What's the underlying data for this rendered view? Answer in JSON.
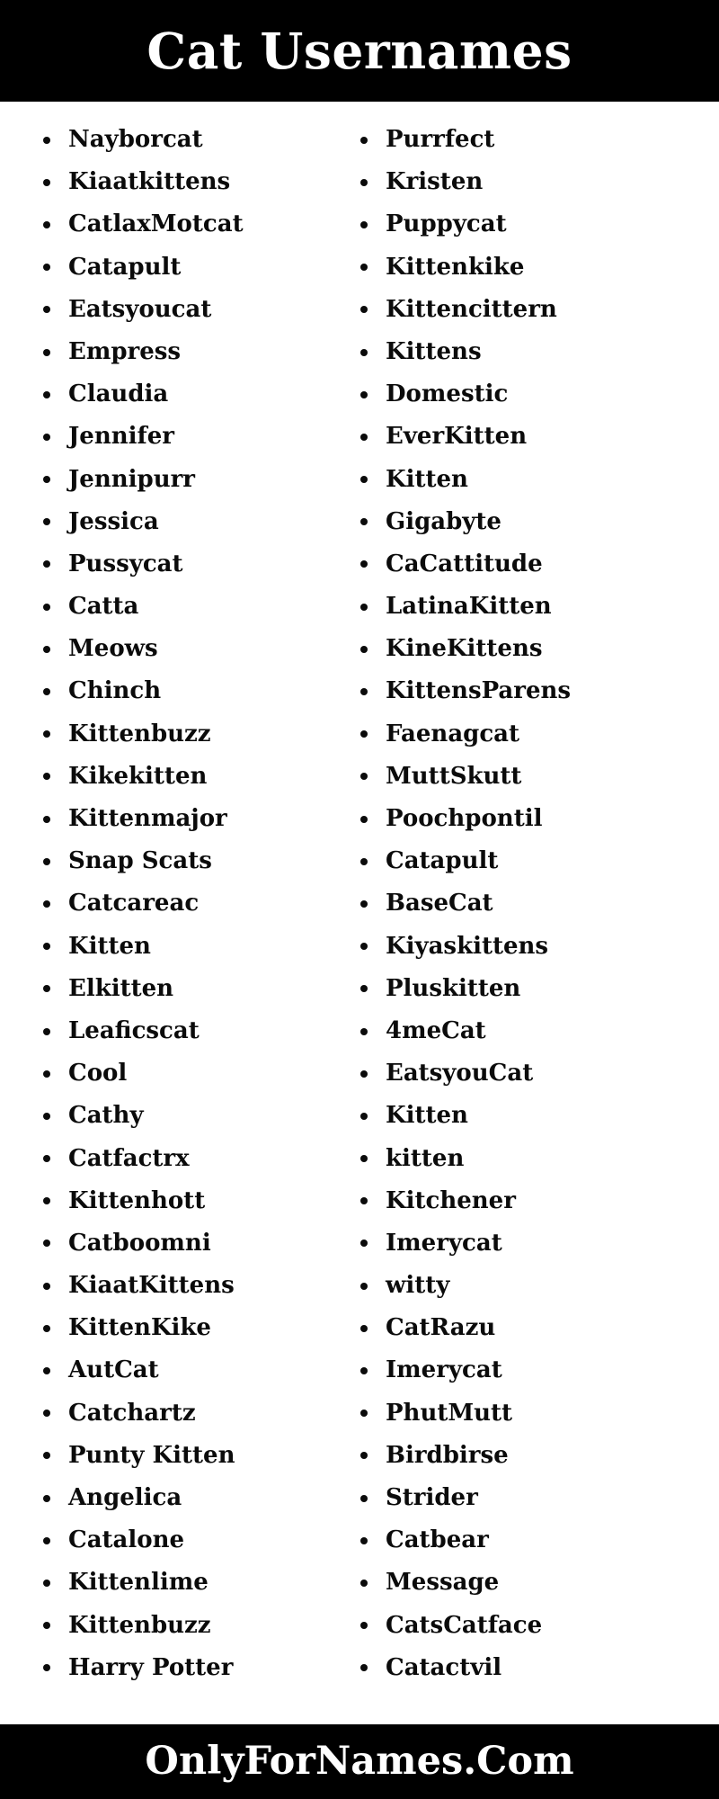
{
  "header": {
    "title": "Cat Usernames",
    "background_color": "#000000",
    "text_color": "#ffffff"
  },
  "footer": {
    "site": "OnlyForNames.Com",
    "background_color": "#000000",
    "text_color": "#ffffff"
  },
  "body": {
    "background_color": "#ffffff",
    "text_color": "#0b0b0b",
    "bullet_color": "#0b0b0b"
  },
  "columns": [
    {
      "id": "left",
      "items": [
        "Nayborcat",
        "Kiaatkittens",
        "CatlaxMotcat",
        "Catapult",
        "Eatsyoucat",
        "Empress",
        "Claudia",
        "Jennifer",
        "Jennipurr",
        "Jessica",
        "Pussycat",
        "Catta",
        "Meows",
        "Chinch",
        "Kittenbuzz",
        "Kikekitten",
        "Kittenmajor",
        "Snap Scats",
        "Catcareac",
        "Kitten",
        "Elkitten",
        "Leaficscat",
        "Cool",
        "Cathy",
        "Catfactrx",
        "Kittenhott",
        "Catboomni",
        "KiaatKittens",
        "KittenKike",
        "AutCat",
        "Catchartz",
        "Punty Kitten",
        "Angelica",
        "Catalone",
        "Kittenlime",
        "Kittenbuzz",
        "Harry Potter"
      ]
    },
    {
      "id": "right",
      "items": [
        "Purrfect",
        "Kristen",
        "Puppycat",
        "Kittenkike",
        "Kittencittern",
        "Kittens",
        "Domestic",
        "EverKitten",
        "Kitten",
        "Gigabyte",
        "CaCattitude",
        "LatinaKitten",
        "KineKittens",
        "KittensParens",
        "Faenagcat",
        "MuttSkutt",
        "Poochpontil",
        "Catapult",
        "BaseCat",
        "Kiyaskittens",
        "Pluskitten",
        "4meCat",
        "EatsyouCat",
        "Kitten",
        "kitten",
        "Kitchener",
        "Imerycat",
        "witty",
        "CatRazu",
        "Imerycat",
        "PhutMutt",
        "Birdbirse",
        "Strider",
        "Catbear",
        "Message",
        "CatsCatface",
        "Catactvil"
      ]
    }
  ]
}
